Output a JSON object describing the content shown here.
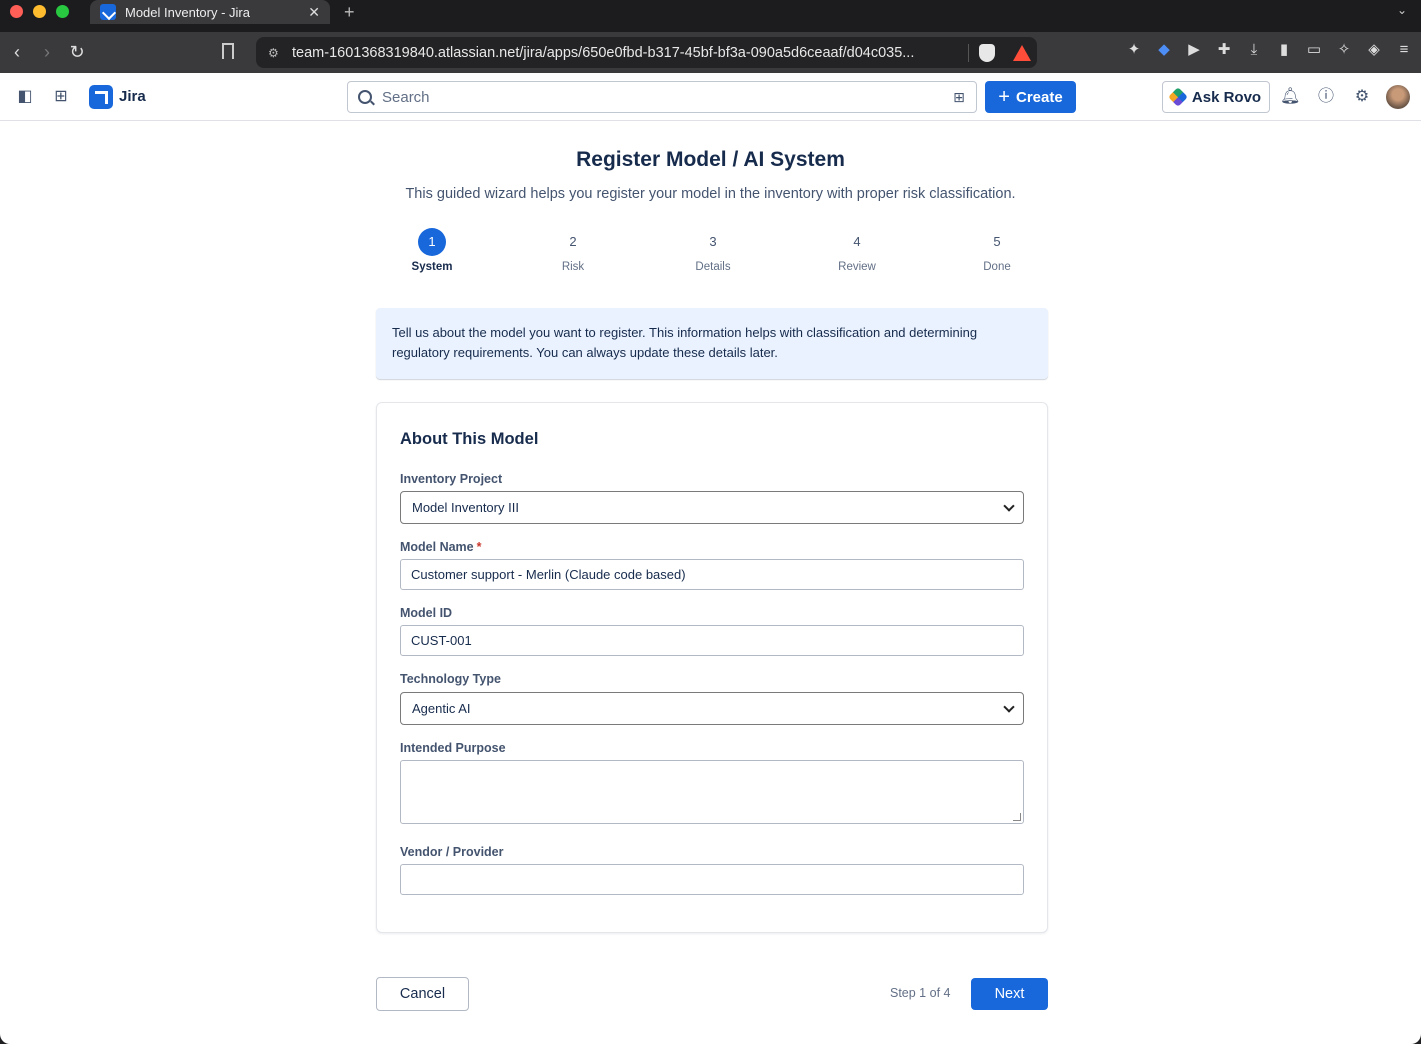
{
  "browser": {
    "tab_title": "Model Inventory - Jira",
    "tab_close": "✕",
    "new_tab": "+",
    "url": "team-1601368319840.atlassian.net/jira/apps/650e0fbd-b317-45bf-bf3a-090a5d6ceaaf/d04c035..."
  },
  "header": {
    "app_name": "Jira",
    "search_placeholder": "Search",
    "create_label": "Create",
    "ask_rovo_label": "Ask Rovo",
    "brand_color": "#1868db"
  },
  "page": {
    "title": "Register Model / AI System",
    "subtitle": "This guided wizard helps you register your model in the inventory with proper risk classification."
  },
  "stepper": {
    "steps": [
      {
        "number": "1",
        "label": "System",
        "active": true
      },
      {
        "number": "2",
        "label": "Risk",
        "active": false
      },
      {
        "number": "3",
        "label": "Details",
        "active": false
      },
      {
        "number": "4",
        "label": "Review",
        "active": false
      },
      {
        "number": "5",
        "label": "Done",
        "active": false
      }
    ]
  },
  "info_banner": {
    "text": "Tell us about the model you want to register. This information helps with classification and determining regulatory requirements. You can always update these details later."
  },
  "form": {
    "title": "About This Model",
    "inventory_project": {
      "label": "Inventory Project",
      "value": "Model Inventory III"
    },
    "model_name": {
      "label": "Model Name",
      "required_marker": "*",
      "value": "Customer support - Merlin (Claude code based)"
    },
    "model_id": {
      "label": "Model ID",
      "value": "CUST-001"
    },
    "technology_type": {
      "label": "Technology Type",
      "value": "Agentic AI"
    },
    "intended_purpose": {
      "label": "Intended Purpose",
      "value": ""
    },
    "vendor": {
      "label": "Vendor / Provider",
      "value": ""
    }
  },
  "footer": {
    "cancel_label": "Cancel",
    "step_indicator": "Step 1 of 4",
    "next_label": "Next"
  }
}
